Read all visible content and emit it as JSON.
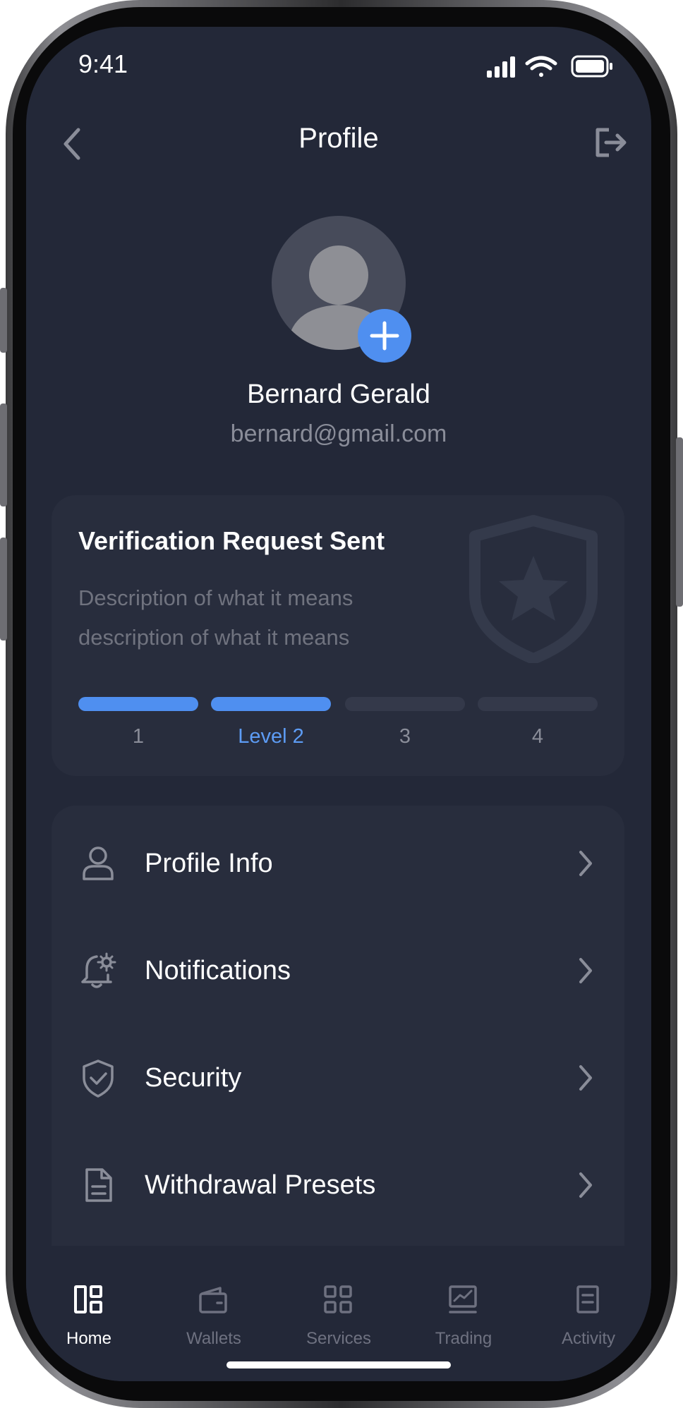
{
  "status_bar": {
    "time": "9:41"
  },
  "nav": {
    "title": "Profile"
  },
  "user": {
    "name": "Bernard Gerald",
    "email": "bernard@gmail.com"
  },
  "verification": {
    "title": "Verification Request Sent",
    "description_line1": "Description of what it means",
    "description_line2": "description of what it means",
    "current_level": 2,
    "levels": [
      {
        "label": "1",
        "active": true
      },
      {
        "label": "Level 2",
        "active": true
      },
      {
        "label": "3",
        "active": false
      },
      {
        "label": "4",
        "active": false
      }
    ]
  },
  "menu": [
    {
      "label": "Profile Info",
      "icon": "user-icon"
    },
    {
      "label": "Notifications",
      "icon": "bell-settings-icon"
    },
    {
      "label": "Security",
      "icon": "shield-check-icon"
    },
    {
      "label": "Withdrawal Presets",
      "icon": "document-icon"
    }
  ],
  "tabs": [
    {
      "label": "Home",
      "icon": "home-grid-icon",
      "active": true
    },
    {
      "label": "Wallets",
      "icon": "wallet-icon",
      "active": false
    },
    {
      "label": "Services",
      "icon": "services-grid-icon",
      "active": false
    },
    {
      "label": "Trading",
      "icon": "chart-icon",
      "active": false
    },
    {
      "label": "Activity",
      "icon": "list-icon",
      "active": false
    }
  ],
  "colors": {
    "background": "#232838",
    "card": "#282d3d",
    "accent": "#4f8ff0"
  }
}
